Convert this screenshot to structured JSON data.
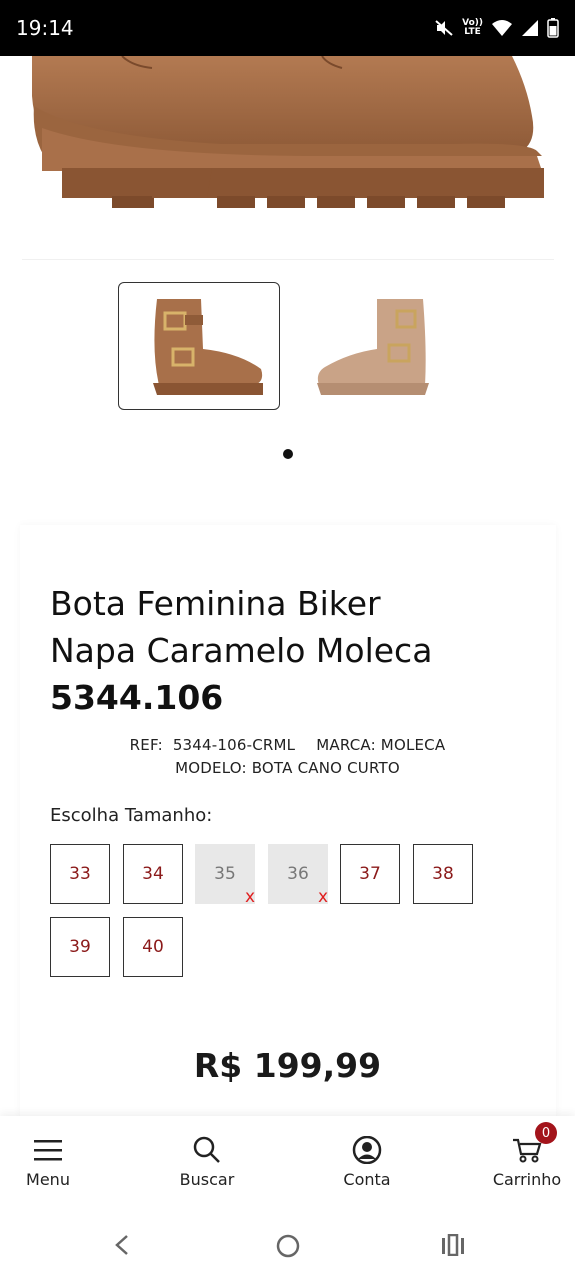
{
  "status_bar": {
    "time": "19:14",
    "icons": [
      "mute-icon",
      "volte-icon",
      "wifi-icon",
      "signal-icon",
      "battery-icon"
    ],
    "volte_text_top": "Vo))",
    "volte_text_bottom": "LTE"
  },
  "product": {
    "title_line1": "Bota Feminina Biker",
    "title_line2": "Napa Caramelo Moleca",
    "title_line3": "5344.106",
    "ref_label": "REF:",
    "ref_value": "5344-106-CRML",
    "brand_label": "MARCA:",
    "brand_value": "MOLECA",
    "model_label": "MODELO:",
    "model_value": "BOTA CANO CURTO",
    "size_prompt": "Escolha Tamanho:",
    "sizes": [
      {
        "label": "33",
        "available": true
      },
      {
        "label": "34",
        "available": true
      },
      {
        "label": "35",
        "available": false
      },
      {
        "label": "36",
        "available": false
      },
      {
        "label": "37",
        "available": true
      },
      {
        "label": "38",
        "available": true
      },
      {
        "label": "39",
        "available": true
      },
      {
        "label": "40",
        "available": true
      }
    ],
    "unavailable_mark": "x",
    "price": "R$ 199,99"
  },
  "gallery": {
    "thumbnail_count": 2,
    "selected_index": 0,
    "dot_count": 1
  },
  "bottom_nav": {
    "items": [
      {
        "label": "Menu",
        "icon": "hamburger-icon"
      },
      {
        "label": "Buscar",
        "icon": "search-icon"
      },
      {
        "label": "Conta",
        "icon": "account-icon"
      },
      {
        "label": "Carrinho",
        "icon": "cart-icon"
      }
    ],
    "cart_count": "0"
  },
  "colors": {
    "size_text": "#8b1a1a",
    "unavailable_x": "#e02020",
    "badge": "#a3141b",
    "boot_primary": "#a8704a",
    "boot_light": "#c9a387"
  }
}
